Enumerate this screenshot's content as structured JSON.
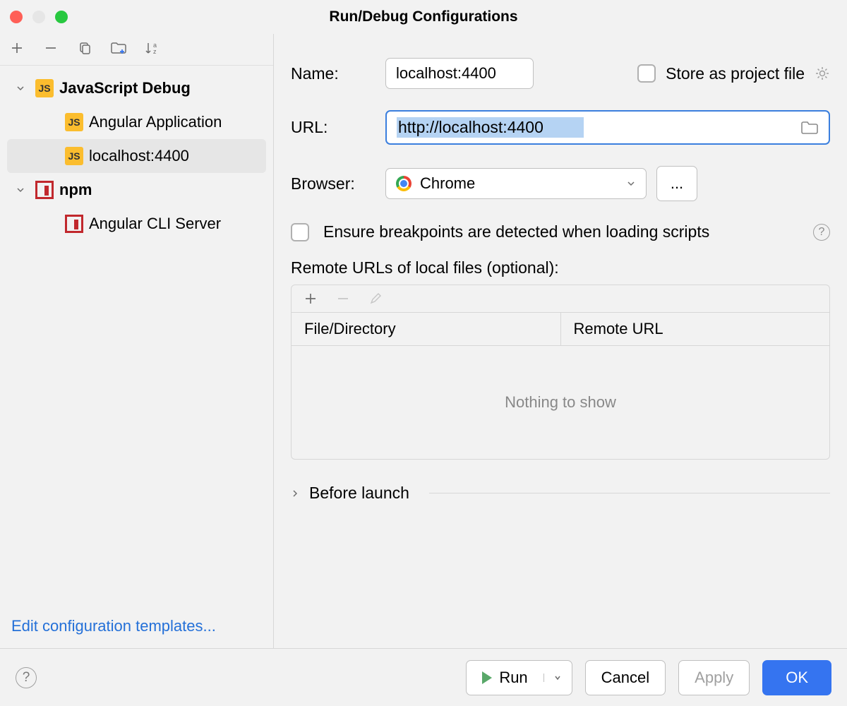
{
  "title": "Run/Debug Configurations",
  "sidebar": {
    "groups": [
      {
        "label": "JavaScript Debug",
        "items": [
          {
            "label": "Angular Application"
          },
          {
            "label": "localhost:4400",
            "selected": true
          }
        ]
      },
      {
        "label": "npm",
        "items": [
          {
            "label": "Angular CLI Server"
          }
        ]
      }
    ],
    "edit_templates": "Edit configuration templates..."
  },
  "form": {
    "name_label": "Name:",
    "name_value": "localhost:4400",
    "store_label": "Store as project file",
    "url_label": "URL:",
    "url_value": "http://localhost:4400",
    "browser_label": "Browser:",
    "browser_value": "Chrome",
    "more": "...",
    "breakpoints_label": "Ensure breakpoints are detected when loading scripts",
    "remote_urls_label": "Remote URLs of local files (optional):",
    "table": {
      "col1": "File/Directory",
      "col2": "Remote URL",
      "empty": "Nothing to show"
    },
    "before_launch": "Before launch"
  },
  "footer": {
    "run": "Run",
    "cancel": "Cancel",
    "apply": "Apply",
    "ok": "OK"
  }
}
